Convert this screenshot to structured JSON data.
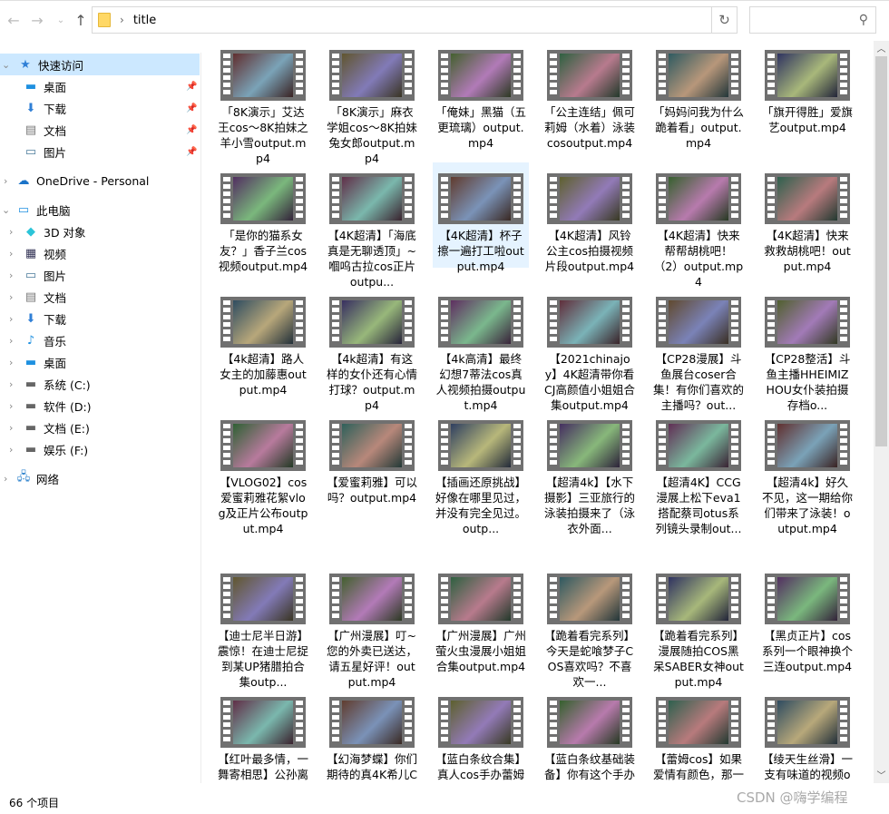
{
  "address": {
    "title": "title",
    "search_placeholder": ""
  },
  "sidebar": {
    "quick_access": "快速访问",
    "quick": [
      "桌面",
      "下载",
      "文档",
      "图片"
    ],
    "onedrive": "OneDrive - Personal",
    "this_pc": "此电脑",
    "pc": [
      "3D 对象",
      "视频",
      "图片",
      "文档",
      "下载",
      "音乐",
      "桌面",
      "系统 (C:)",
      "软件 (D:)",
      "文档 (E:)",
      "娱乐 (F:)"
    ],
    "network": "网络"
  },
  "files": [
    "「8K演示」艾达王cos～8K拍妹之羊小雪output.mp4",
    "「8K演示」麻衣学姐cos～8K拍妹兔女郎output.mp4",
    "「俺妹」黑猫（五更琉璃）output.mp4",
    "「公主连结」佩可莉姆（水着）泳装cosoutput.mp4",
    "「妈妈问我为什么跪着看」output.mp4",
    "「旗开得胜」爱旗艺output.mp4",
    "「是你的猫系女友？」香子兰cos视频output.mp4",
    "【4K超清】「海底真是无聊透顶」~嗰呜古拉cos正片outpu...",
    "【4K超清】杯子擦一遍打工啦output.mp4",
    "【4K超清】风铃公主cos拍摄视频片段output.mp4",
    "【4K超清】快来帮帮胡桃吧！（2）output.mp4",
    "【4K超清】快来救救胡桃吧！output.mp4",
    "【4k超清】路人女主的加藤惠output.mp4",
    "【4k超清】有这样的女仆还有心情打球？output.mp4",
    "【4k高清】最终幻想7蒂法cos真人视频拍摄output.mp4",
    "【2021chinajoy】4K超清带你看CJ高颜值小姐姐合集output.mp4",
    "【CP28漫展】斗鱼展台coser合集！有你们喜欢的主播吗？out...",
    "【CP28整活】斗鱼主播HHEIMIZHOU女仆装拍摄存档o...",
    "【VLOG02】cos爱蜜莉雅花絮vlog及正片公布output.mp4",
    "【爱蜜莉雅】可以吗？output.mp4",
    "【插画还原挑战】好像在哪里见过，并没有完全见过。outp...",
    "【超清4k】【水下摄影】三亚旅行的泳装拍摄来了（泳衣外面...",
    "【超清4K】CCG漫展上松下eva1搭配蔡司otus系列镜头录制out...",
    "【超清4k】好久不见，这一期给你们带来了泳装！output.mp4",
    "【迪士尼半日游】震惊！在迪士尼捉到某UP猪腊拍合集outp...",
    "【广州漫展】叮~您的外卖已送达，请五星好评！output.mp4",
    "【广州漫展】广州萤火虫漫展小姐姐合集output.mp4",
    "【跪着看完系列】今天是蛇喰梦子COS喜欢吗？不喜欢一...",
    "【跪着看完系列】漫展随拍COS黑呆SABER女神output.mp4",
    "【黑贞正片】cos系列一个眼神换个三连output.mp4",
    "【红叶最多情，一舞寄相思】公孙离原皮肤cos来",
    "【幻海梦蝶】你们期待的真4K希儿COS来了崩坏",
    "【蓝白条纹合集】真人cos手办蕾姆系列合集",
    "【蓝白条纹基础装备】你有这个手办吗？",
    "【蕾姆cos】如果爱情有颜色，那一定是蓝色",
    "【绫天生丝滑】一支有味道的视频output.mp4"
  ],
  "selected_index": 8,
  "status": {
    "count": "66 个项目"
  },
  "watermark": "CSDN @嗨学编程"
}
